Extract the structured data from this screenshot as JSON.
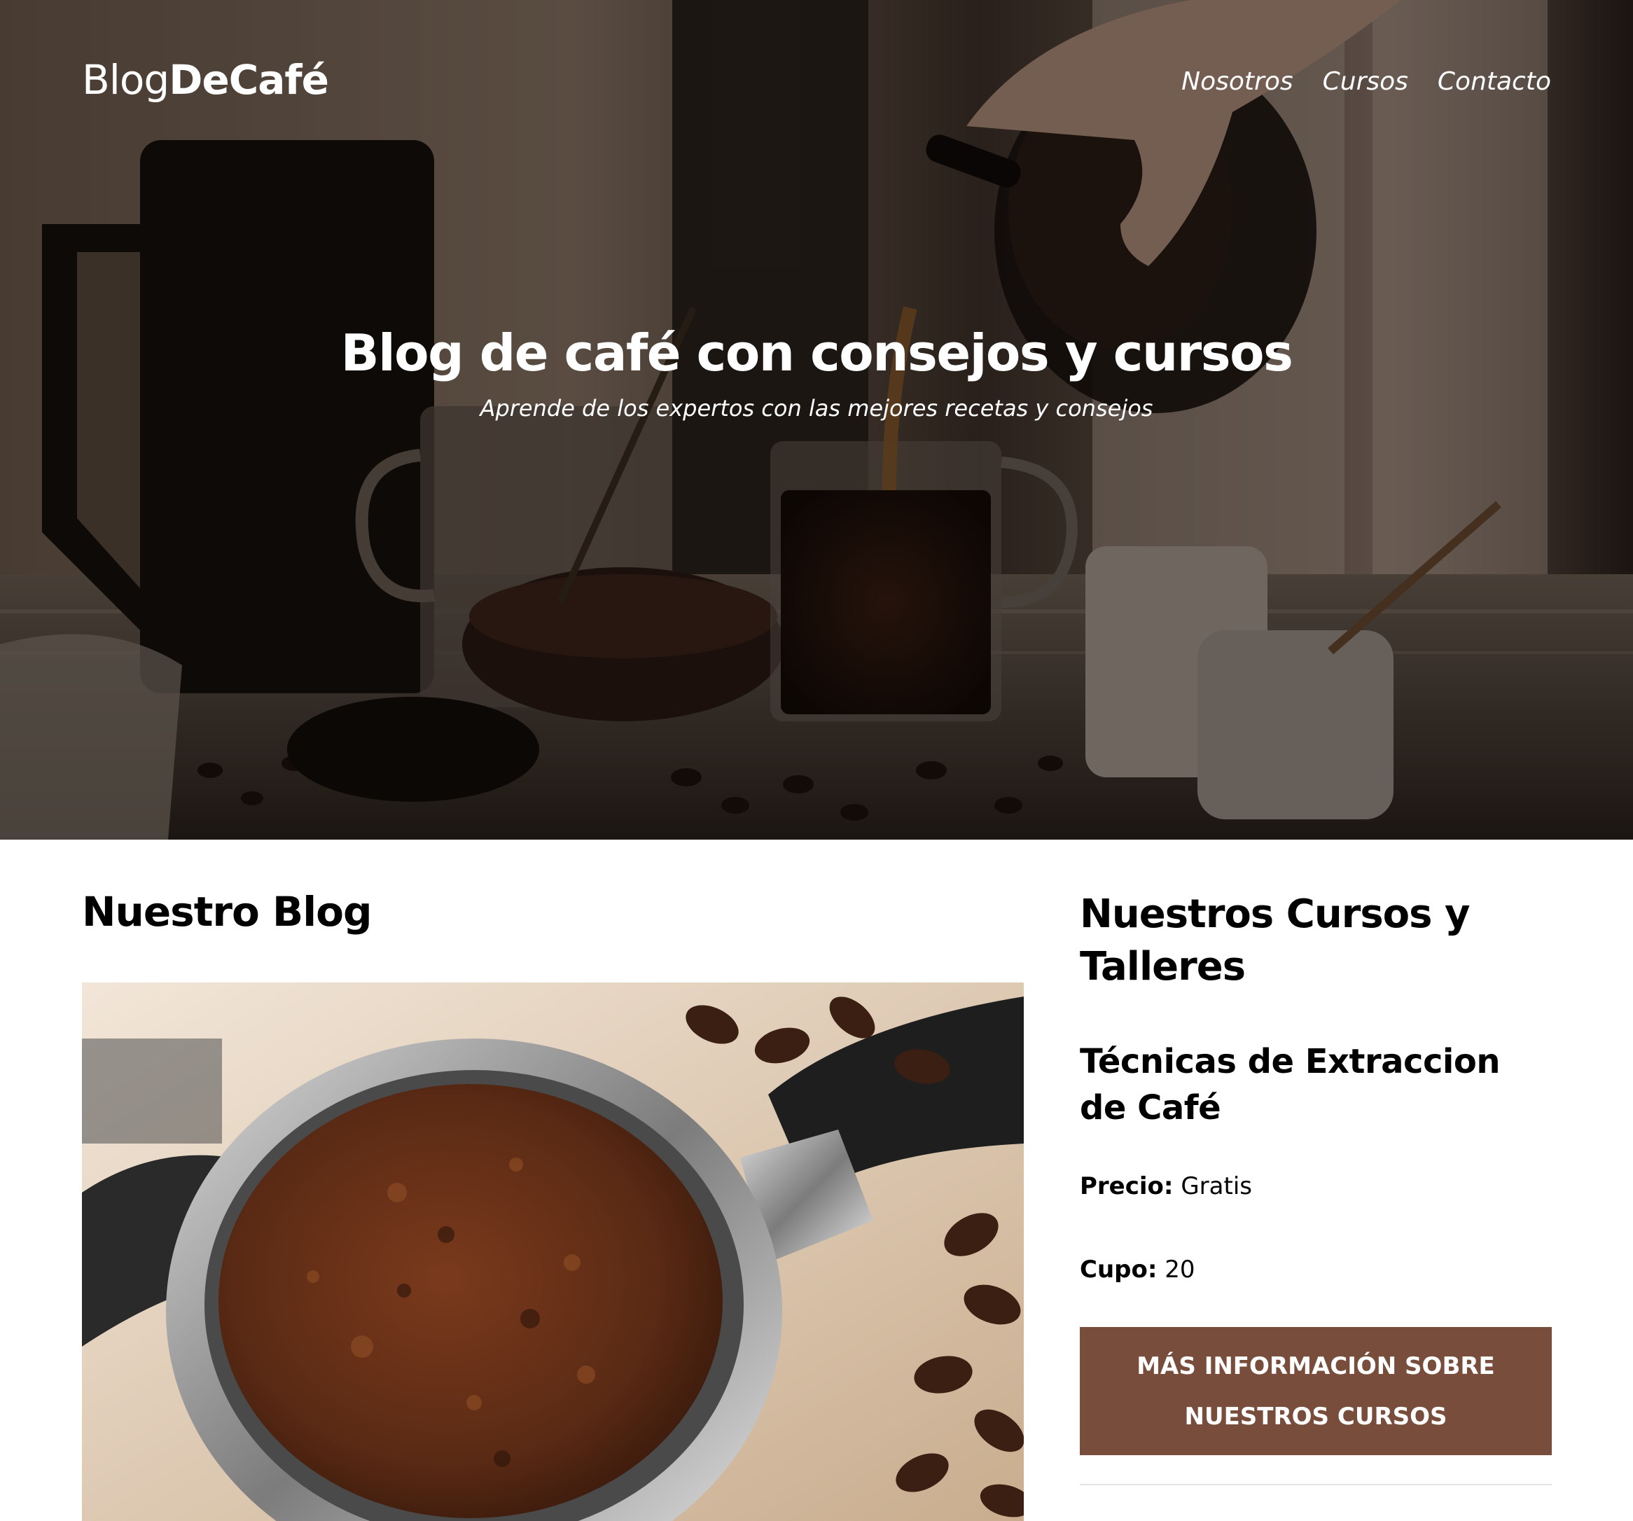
{
  "header": {
    "logo_regular": "Blog",
    "logo_bold": "DeCafé",
    "nav": [
      {
        "label": "Nosotros"
      },
      {
        "label": "Cursos"
      },
      {
        "label": "Contacto"
      }
    ]
  },
  "hero": {
    "title": "Blog de café con consejos y cursos",
    "subtitle": "Aprende de los expertos con las mejores recetas y consejos",
    "image": "coffee-pouring-photo"
  },
  "blog": {
    "heading": "Nuestro Blog",
    "image": "espresso-portafilter-photo"
  },
  "courses": {
    "heading": "Nuestros Cursos y Talleres",
    "item": {
      "title": "Técnicas de Extraccion de Café",
      "price_label": "Precio:",
      "price_value": "Gratis",
      "seats_label": "Cupo:",
      "seats_value": "20"
    },
    "button_label": "Más Información sobre nuestros cursos"
  },
  "colors": {
    "accent": "#784d3c",
    "text": "#000000",
    "background": "#ffffff"
  }
}
